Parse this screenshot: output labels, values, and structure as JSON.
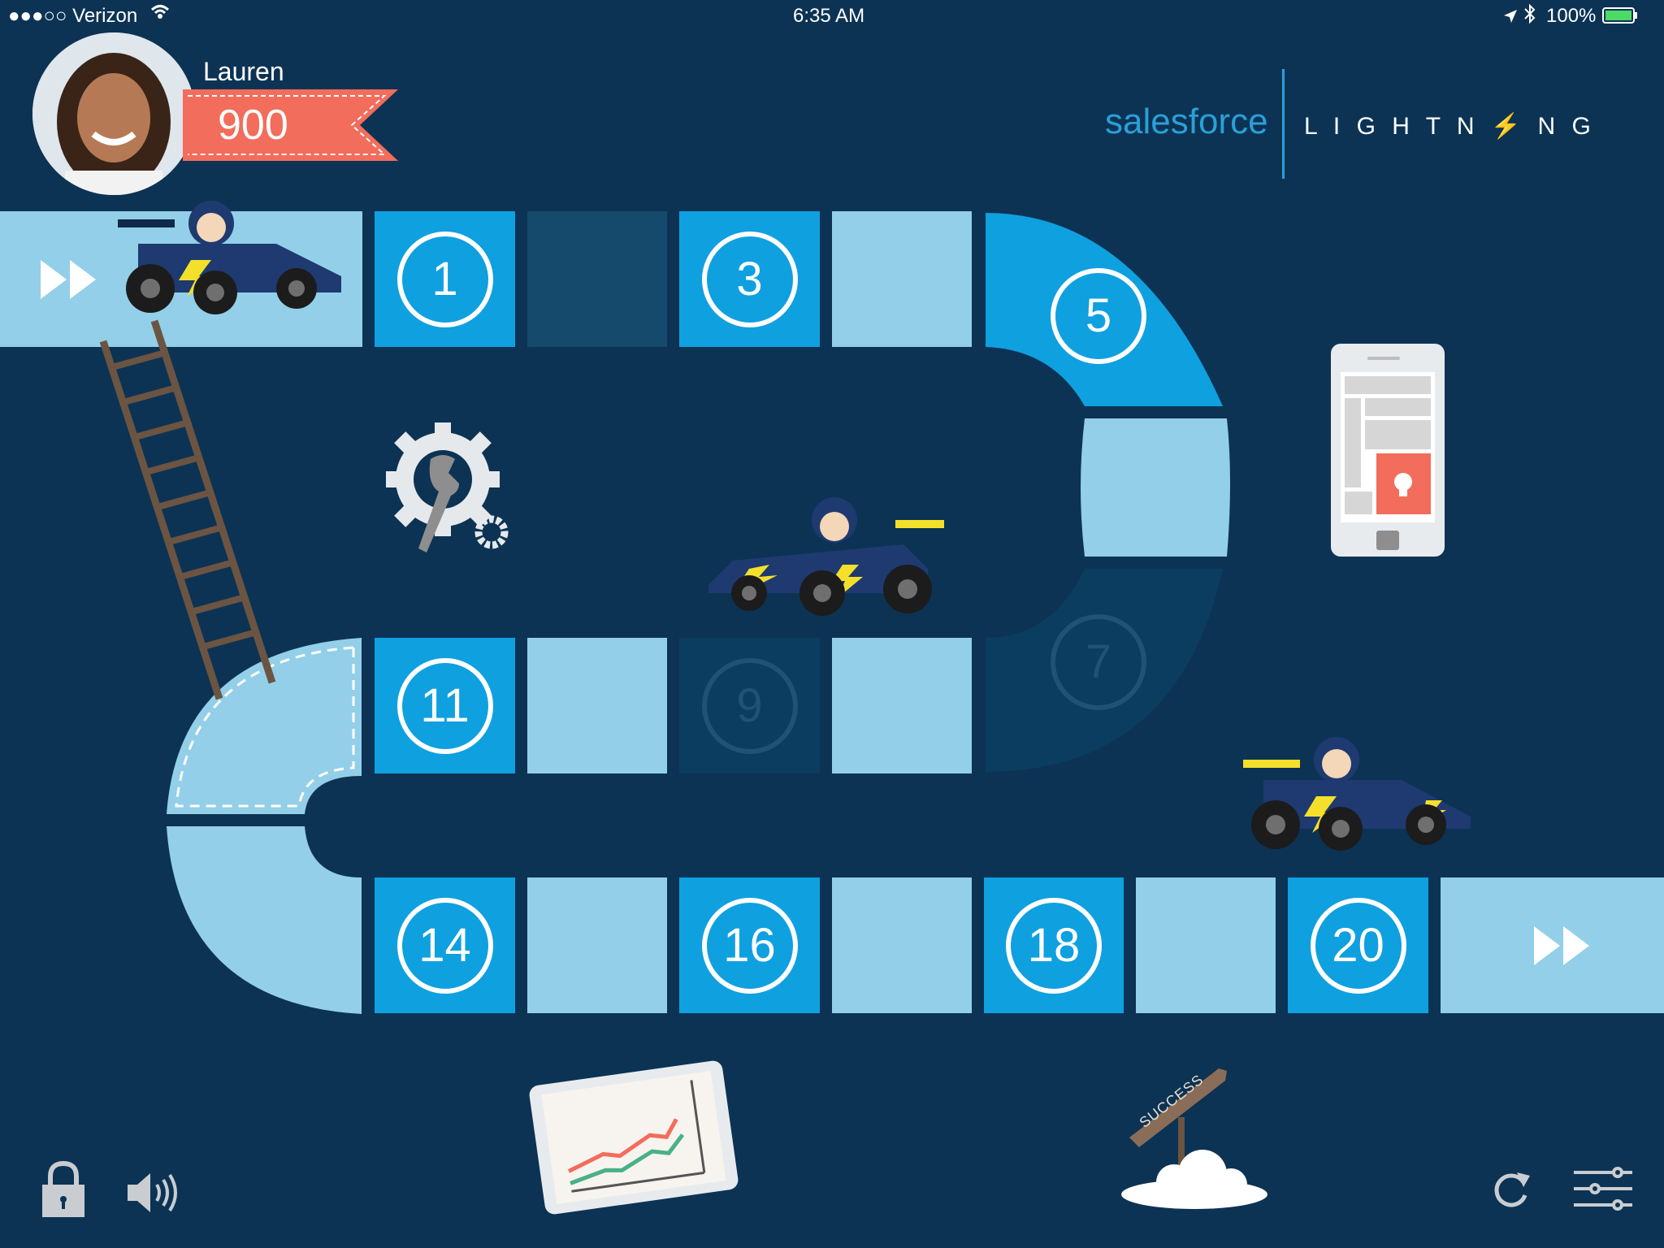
{
  "status_bar": {
    "carrier": "●●●○○ Verizon",
    "time": "6:35 AM",
    "battery": "100%"
  },
  "player": {
    "name": "Lauren",
    "score": "900"
  },
  "brand": {
    "salesforce": "salesforce",
    "lightning": "L I G H T N ⚡ N G"
  },
  "board": {
    "tiles": [
      {
        "label": "1"
      },
      {
        "label": "3"
      },
      {
        "label": "5"
      },
      {
        "label": "7"
      },
      {
        "label": "9"
      },
      {
        "label": "11"
      },
      {
        "label": "14"
      },
      {
        "label": "16"
      },
      {
        "label": "18"
      },
      {
        "label": "20"
      }
    ]
  },
  "decor": {
    "signpost": "SUCCESS"
  },
  "colors": {
    "background": "#0c3354",
    "tile_light": "#93cfe8",
    "tile_blue": "#0fa0e0",
    "score_ribbon": "#f26d5b"
  },
  "icons": [
    "wifi-icon",
    "location-icon",
    "bluetooth-icon",
    "battery-icon",
    "fast-forward-icon",
    "lock-icon",
    "speaker-icon",
    "refresh-icon",
    "settings-sliders-icon"
  ]
}
